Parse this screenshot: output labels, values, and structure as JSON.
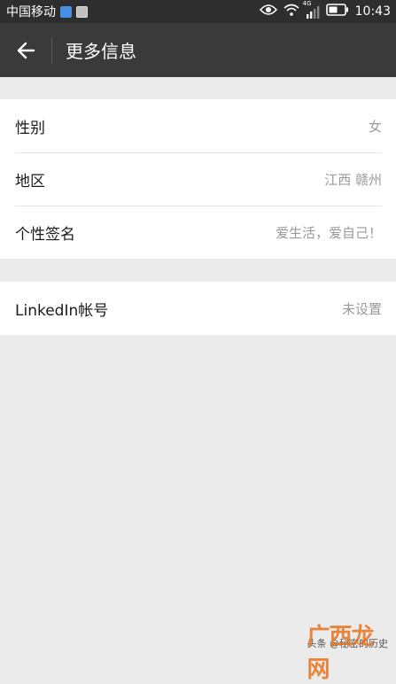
{
  "status_bar": {
    "carrier": "中国移动",
    "network": "4G",
    "time": "10:43"
  },
  "header": {
    "title": "更多信息"
  },
  "groups": [
    {
      "rows": [
        {
          "label": "性别",
          "value": "女"
        },
        {
          "label": "地区",
          "value": "江西 赣州"
        },
        {
          "label": "个性签名",
          "value": "爱生活，爱自己！"
        }
      ]
    },
    {
      "rows": [
        {
          "label": "LinkedIn帐号",
          "value": "未设置"
        }
      ]
    }
  ],
  "watermark": {
    "text": "头条 @秘密的历史",
    "logo_text": "广西龙网"
  },
  "colors": {
    "status_bar_bg": "#2e2e2e",
    "nav_bar_bg": "#3a3a3a",
    "page_bg": "#ebebeb",
    "row_bg": "#ffffff",
    "label_color": "#1a1a1a",
    "value_color": "#9a9a9a",
    "logo_color": "#e8731e"
  },
  "icons": [
    "app-notification-icon",
    "gallery-notification-icon",
    "eye-icon",
    "wifi-icon",
    "signal-icon",
    "battery-icon",
    "back-arrow-icon"
  ]
}
